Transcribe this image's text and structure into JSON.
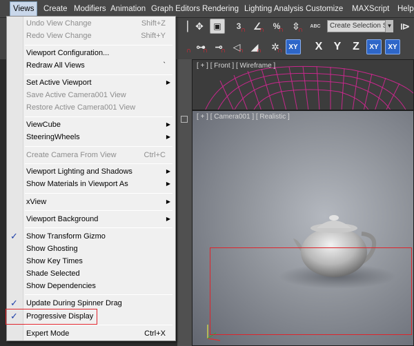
{
  "menubar": {
    "items": [
      "Views",
      "Create",
      "Modifiers",
      "Animation",
      "Graph Editors",
      "Rendering",
      "Lighting Analysis",
      "Customize",
      "MAXScript",
      "Help"
    ]
  },
  "toolbar": {
    "selection_set_placeholder": "Create Selection Se",
    "axis_labels": [
      "X",
      "Y",
      "Z",
      "XY",
      "XY"
    ],
    "row1_glyphs": [
      "3",
      "%",
      "n"
    ],
    "abc": "ABC"
  },
  "viewports": {
    "front_label": "[ + ] [ Front ] [ Wireframe ]",
    "camera_label": "[ + ] [ Camera001 ] [ Realistic ]"
  },
  "menu": {
    "items": [
      {
        "label": "Undo View Change",
        "shortcut": "Shift+Z",
        "disabled": true
      },
      {
        "label": "Redo View Change",
        "shortcut": "Shift+Y",
        "disabled": true
      },
      {
        "label": "Viewport Configuration...",
        "shortcut": "",
        "disabled": false
      },
      {
        "label": "Redraw All Views",
        "shortcut": "`",
        "disabled": false
      },
      {
        "label": "Set Active Viewport",
        "shortcut": "",
        "disabled": false,
        "submenu": true
      },
      {
        "label": "Save Active Camera001 View",
        "shortcut": "",
        "disabled": true
      },
      {
        "label": "Restore Active Camera001 View",
        "shortcut": "",
        "disabled": true
      },
      {
        "label": "ViewCube",
        "shortcut": "",
        "disabled": false,
        "submenu": true
      },
      {
        "label": "SteeringWheels",
        "shortcut": "",
        "disabled": false,
        "submenu": true
      },
      {
        "label": "Create Camera From View",
        "shortcut": "Ctrl+C",
        "disabled": true
      },
      {
        "label": "Viewport Lighting and Shadows",
        "shortcut": "",
        "disabled": false,
        "submenu": true
      },
      {
        "label": "Show Materials in Viewport As",
        "shortcut": "",
        "disabled": false,
        "submenu": true
      },
      {
        "label": "xView",
        "shortcut": "",
        "disabled": false,
        "submenu": true
      },
      {
        "label": "Viewport Background",
        "shortcut": "",
        "disabled": false,
        "submenu": true
      },
      {
        "label": "Show Transform Gizmo",
        "shortcut": "",
        "disabled": false,
        "checked": true
      },
      {
        "label": "Show Ghosting",
        "shortcut": "",
        "disabled": false
      },
      {
        "label": "Show Key Times",
        "shortcut": "",
        "disabled": false
      },
      {
        "label": "Shade Selected",
        "shortcut": "",
        "disabled": false
      },
      {
        "label": "Show Dependencies",
        "shortcut": "",
        "disabled": false
      },
      {
        "label": "Update During Spinner Drag",
        "shortcut": "",
        "disabled": false,
        "checked": true
      },
      {
        "label": "Progressive Display",
        "shortcut": "",
        "disabled": false,
        "checked": true
      },
      {
        "label": "Expert Mode",
        "shortcut": "Ctrl+X",
        "disabled": false
      }
    ]
  },
  "colors": {
    "highlight": "#e0232a",
    "checkmark": "#1c3ea8",
    "wireframe": "#c8288c"
  }
}
